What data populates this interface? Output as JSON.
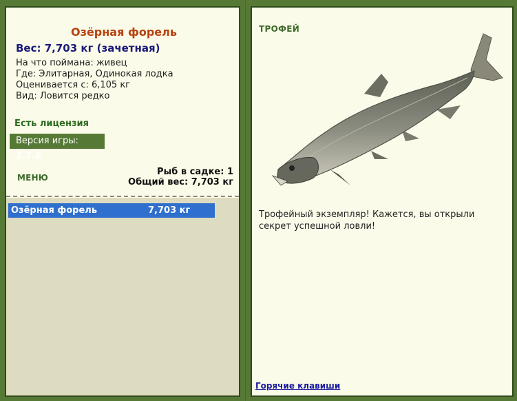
{
  "fish": {
    "name": "Озёрная форель",
    "weight_line": "Вес: 7,703 кг (зачетная)",
    "caught_on": "На что поймана: живец",
    "location": "Где: Элитарная, Одинокая лодка",
    "valued_from": "Оценивается с: 6,105 кг",
    "kind": "Вид: Ловится редко"
  },
  "license": "Есть лицензия",
  "version": {
    "label": "Версия игры:",
    "value": "3.7.6"
  },
  "menu_label": "МЕНЮ",
  "keepnet": {
    "count": "Рыб в садке: 1",
    "total": "Общий вес: 7,703 кг"
  },
  "catch_list": [
    {
      "name": "Озёрная форель",
      "weight": "7,703 кг"
    }
  ],
  "trophy": {
    "heading": "ТРОФЕЙ",
    "message": "Трофейный экземпляр! Кажется, вы открыли секрет успешной ловли!"
  },
  "hotkeys_link": "Горячие клавиши",
  "colors": {
    "frame": "#567a35",
    "panel": "#fbfbe9",
    "selection": "#2f6fcd",
    "title": "#b7420f"
  }
}
